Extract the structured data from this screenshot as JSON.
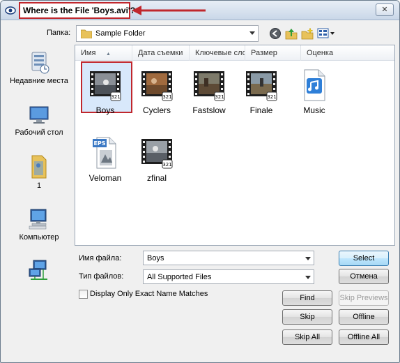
{
  "title_bar": {
    "title": "Where is the File 'Boys.avi'?",
    "close_glyph": "✕",
    "highlight_color": "#c0272d"
  },
  "location": {
    "label": "Папка:",
    "value": "Sample Folder"
  },
  "toolbar_icons": [
    "back-icon",
    "up-folder-icon",
    "new-folder-icon",
    "views-menu-icon"
  ],
  "places": [
    {
      "label": "Недавние места",
      "icon": "recent-places-icon"
    },
    {
      "label": "Рабочий стол",
      "icon": "desktop-icon"
    },
    {
      "label": "1",
      "icon": "user-folder-icon"
    },
    {
      "label": "Компьютер",
      "icon": "computer-icon"
    },
    {
      "label": "",
      "icon": "network-icon"
    }
  ],
  "columns": [
    "Имя",
    "Дата съемки",
    "Ключевые слова",
    "Размер",
    "Оценка"
  ],
  "files": [
    {
      "name": "Boys",
      "type": "video",
      "selected": true
    },
    {
      "name": "Cyclers",
      "type": "video",
      "selected": false
    },
    {
      "name": "Fastslow",
      "type": "video",
      "selected": false
    },
    {
      "name": "Finale",
      "type": "video",
      "selected": false
    },
    {
      "name": "Music",
      "type": "audio",
      "selected": false
    },
    {
      "name": "Veloman",
      "type": "eps",
      "selected": false
    },
    {
      "name": "zfinal",
      "type": "video",
      "selected": false
    }
  ],
  "badge_text": "321",
  "eps_text": "EPS",
  "form": {
    "filename_label": "Имя файла:",
    "filename_value": "Boys",
    "filetype_label": "Тип файлов:",
    "filetype_value": "All Supported Files",
    "exact_match_label": "Display Only Exact Name Matches",
    "exact_match_checked": false
  },
  "buttons": {
    "select": "Select",
    "cancel": "Отмена",
    "find": "Find",
    "skip_previews": "Skip Previews",
    "skip": "Skip",
    "offline": "Offline",
    "skip_all": "Skip All",
    "offline_all": "Offline All"
  }
}
